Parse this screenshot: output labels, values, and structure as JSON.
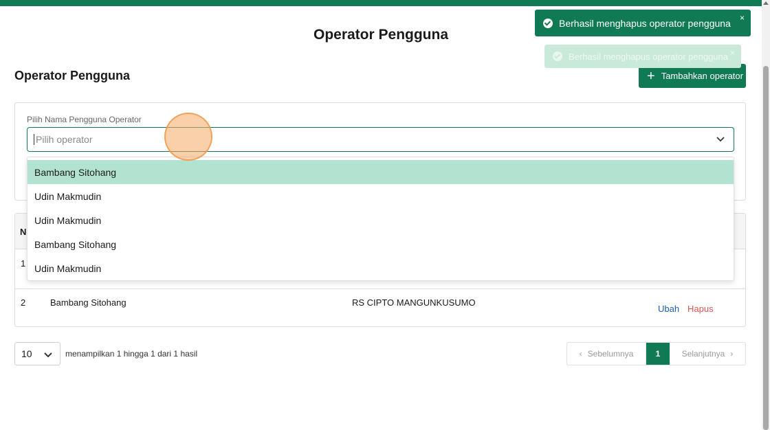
{
  "page": {
    "title": "Operator Pengguna",
    "section_title": "Operator Pengguna",
    "add_button_label": "Tambahkan operator"
  },
  "filter": {
    "label": "Pilih Nama Pengguna Operator",
    "placeholder": "Pilih operator",
    "options": [
      "Bambang Sitohang",
      "Udin Makmudin",
      "Udin Makmudin",
      "Bambang Sitohang",
      "Udin Makmudin"
    ],
    "highlighted_index": 0
  },
  "table": {
    "header_no": "No",
    "rows": [
      {
        "no": "1"
      },
      {
        "no": "2",
        "name": "Bambang Sitohang",
        "hospital": "RS CIPTO MANGUNKUSUMO",
        "edit": "Ubah",
        "delete": "Hapus"
      }
    ]
  },
  "pagination": {
    "page_size": "10",
    "info": "menampilkan 1 hingga 1 dari 1 hasil",
    "prev": "Sebelumnya",
    "current": "1",
    "next": "Selanjutnya"
  },
  "toasts": [
    {
      "message": "Berhasil menghapus operator pengguna",
      "close": "×"
    },
    {
      "message": "Berhasil menghapus operator pengguna",
      "close": "×"
    }
  ],
  "colors": {
    "primary": "#107a55",
    "highlight": "#b2e3d1",
    "link": "#1e5fa8",
    "danger": "#d9534f"
  }
}
